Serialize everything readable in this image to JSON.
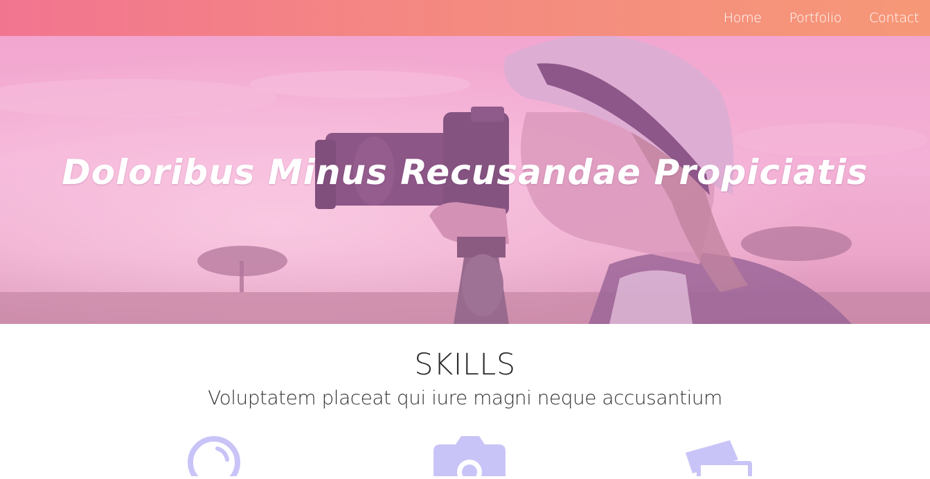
{
  "nav": {
    "links": [
      {
        "label": "Home"
      },
      {
        "label": "Portfolio"
      },
      {
        "label": "Contact"
      }
    ]
  },
  "hero": {
    "title": "Doloribus Minus Recusandae Propiciatis"
  },
  "skills": {
    "title": "SKILLS",
    "subtitle": "Voluptatem placeat qui iure magni neque accusantium",
    "icons": [
      "lens-icon",
      "camera-icon",
      "photos-icon"
    ]
  },
  "colors": {
    "accent": "#f48a80",
    "icon": "#c9c4f7"
  }
}
